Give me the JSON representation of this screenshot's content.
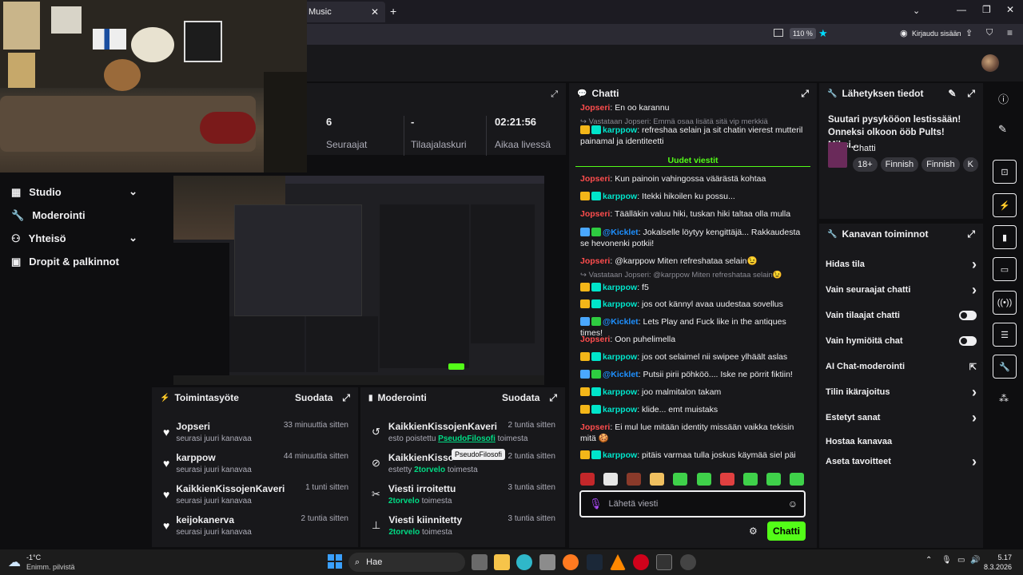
{
  "browser": {
    "tab_title": "Music",
    "zoom": "110 %",
    "login": "Kirjaudu sisään"
  },
  "stats": [
    {
      "value": "6",
      "label": "Seuraajat"
    },
    {
      "value": "-",
      "label": "Tilaajalaskuri"
    },
    {
      "value": "02:21:56",
      "label": "Aikaa livessä"
    }
  ],
  "sidenav": [
    {
      "label": "Studio",
      "icon": "video-icon",
      "chevron": true
    },
    {
      "label": "Moderointi",
      "icon": "wrench-icon",
      "chevron": false
    },
    {
      "label": "Yhteisö",
      "icon": "people-icon",
      "chevron": true
    },
    {
      "label": "Dropit & palkinnot",
      "icon": "gift-icon",
      "chevron": false
    }
  ],
  "activity": {
    "title": "Toimintasyöte",
    "filter": "Suodata",
    "items": [
      {
        "name": "Jopseri",
        "sub": "seurasi juuri kanavaa",
        "time": "33 minuuttia sitten"
      },
      {
        "name": "karppow",
        "sub": "seurasi juuri kanavaa",
        "time": "44 minuuttia sitten"
      },
      {
        "name": "KaikkienKissojenKaveri",
        "sub": "seurasi juuri kanavaa",
        "time": "1 tunti sitten"
      },
      {
        "name": "keijokanerva",
        "sub": "seurasi juuri kanavaa",
        "time": "2 tuntia sitten"
      }
    ]
  },
  "moderation": {
    "title": "Moderointi",
    "filter": "Suodata",
    "tooltip": "PseudoFilosofi",
    "items": [
      {
        "name": "KaikkienKissojenKaveri",
        "pre": "esto poistettu ",
        "target": "PseudoFilosofi",
        "post": " toimesta",
        "time": "2 tuntia sitten",
        "icon": "undo-icon"
      },
      {
        "name": "KaikkienKisso",
        "pre": "estetty ",
        "target": "2torvelo",
        "post": " toimesta",
        "time": "2 tuntia sitten",
        "icon": "ban-icon"
      },
      {
        "name": "Viesti irroitettu",
        "pre": "",
        "target": "2torvelo",
        "post": " toimesta",
        "time": "3 tuntia sitten",
        "icon": "unpin-icon"
      },
      {
        "name": "Viesti kiinnitetty",
        "pre": "",
        "target": "2torvelo",
        "post": " toimesta",
        "time": "3 tuntia sitten",
        "icon": "pin-icon"
      }
    ]
  },
  "chat": {
    "title": "Chatti",
    "new_messages": "Uudet viestit",
    "input_placeholder": "Lähetä viesti",
    "send_label": "Chatti",
    "messages": [
      {
        "type": "msg",
        "user": "Jopseri",
        "color": "#ff4d4d",
        "badges": [],
        "text": "En oo karannu"
      },
      {
        "type": "reply",
        "text": "Vastataan Jopseri: Emmä osaa lisätä sitä vip merkkiä"
      },
      {
        "type": "msg",
        "user": "karppow",
        "color": "#00e5cb",
        "badges": [
          "crown",
          "vip"
        ],
        "text": "refreshaa selain ja sit chatin vierest mutteril painamal ja identiteetti"
      },
      {
        "type": "divider"
      },
      {
        "type": "msg",
        "user": "Jopseri",
        "color": "#ff4d4d",
        "badges": [],
        "text": "Kun painoin vahingossa väärästä kohtaa"
      },
      {
        "type": "msg",
        "user": "karppow",
        "color": "#00e5cb",
        "badges": [
          "crown",
          "vip"
        ],
        "text": "Itekki hikoilen ku possu..."
      },
      {
        "type": "msg",
        "user": "Jopseri",
        "color": "#ff4d4d",
        "badges": [],
        "text": "Täälläkin valuu hiki, tuskan hiki taltaa olla mulla"
      },
      {
        "type": "msg",
        "user": "@Kicklet",
        "color": "#1e90ff",
        "badges": [
          "bot",
          "verified"
        ],
        "text": "Jokalselle löytyy kengittäjä... Rakkaudesta se hevonenki potkii!"
      },
      {
        "type": "msg",
        "user": "Jopseri",
        "color": "#ff4d4d",
        "badges": [],
        "text": "@karppow Miten refreshataa selain😉"
      },
      {
        "type": "reply",
        "text": "Vastataan Jopseri: @karppow Miten refreshataa selain😉"
      },
      {
        "type": "msg",
        "user": "karppow",
        "color": "#00e5cb",
        "badges": [
          "crown",
          "vip"
        ],
        "text": "f5"
      },
      {
        "type": "msg",
        "user": "karppow",
        "color": "#00e5cb",
        "badges": [
          "crown",
          "vip"
        ],
        "text": "jos oot kännyl avaa uudestaa sovellus"
      },
      {
        "type": "msg",
        "user": "@Kicklet",
        "color": "#1e90ff",
        "badges": [
          "bot",
          "verified"
        ],
        "text": "Lets Play and Fuck like in the antiques times!"
      },
      {
        "type": "msg",
        "user": "Jopseri",
        "color": "#ff4d4d",
        "badges": [],
        "text": "Oon puhelimella"
      },
      {
        "type": "msg",
        "user": "karppow",
        "color": "#00e5cb",
        "badges": [
          "crown",
          "vip"
        ],
        "text": "jos oot selaimel nii swipee ylhäält aslas"
      },
      {
        "type": "msg",
        "user": "@Kicklet",
        "color": "#1e90ff",
        "badges": [
          "bot",
          "verified"
        ],
        "text": "Putsii pirii pöhköö.... Iske ne pörrit fiktiin!"
      },
      {
        "type": "msg",
        "user": "karppow",
        "color": "#00e5cb",
        "badges": [
          "crown",
          "vip"
        ],
        "text": "joo malmitalon takam"
      },
      {
        "type": "msg",
        "user": "karppow",
        "color": "#00e5cb",
        "badges": [
          "crown",
          "vip"
        ],
        "text": "klide... emt muistaks"
      },
      {
        "type": "msg",
        "user": "Jopseri",
        "color": "#ff4d4d",
        "badges": [],
        "text": "Ei mul lue mitään identity missään vaikka tekisin mitä 🍪"
      },
      {
        "type": "msg",
        "user": "karppow",
        "color": "#00e5cb",
        "badges": [
          "crown",
          "vip"
        ],
        "text": "pitäis varmaa tulla joskus käymää siel päi"
      }
    ]
  },
  "stream_info": {
    "title": "Lähetyksen tiedot",
    "stream_title": "Suutari pysykööon lestissään! Onneksi olkoon ööb Pults! Miksi...",
    "category": "Chatti",
    "tags": [
      "18+",
      "Finnish",
      "Finnish",
      "K"
    ]
  },
  "channel_actions": {
    "title": "Kanavan toiminnot",
    "items": [
      {
        "label": "Hidas tila",
        "control": "chevron"
      },
      {
        "label": "Vain seuraajat chatti",
        "control": "chevron"
      },
      {
        "label": "Vain tilaajat chatti",
        "control": "toggle"
      },
      {
        "label": "Vain hymiöitä chat",
        "control": "toggle"
      },
      {
        "label": "AI Chat-moderointi",
        "control": "external"
      },
      {
        "label": "Tilin ikärajoitus",
        "control": "chevron"
      },
      {
        "label": "Estetyt sanat",
        "control": "chevron"
      },
      {
        "label": "Hostaa kanavaa",
        "control": "none"
      },
      {
        "label": "Aseta tavoitteet",
        "control": "chevron"
      }
    ]
  },
  "taskbar": {
    "weather_temp": "-1°C",
    "weather_desc": "Enimm. pilvistä",
    "search": "Hae",
    "time": "5.17",
    "date": "8.3.2026"
  }
}
